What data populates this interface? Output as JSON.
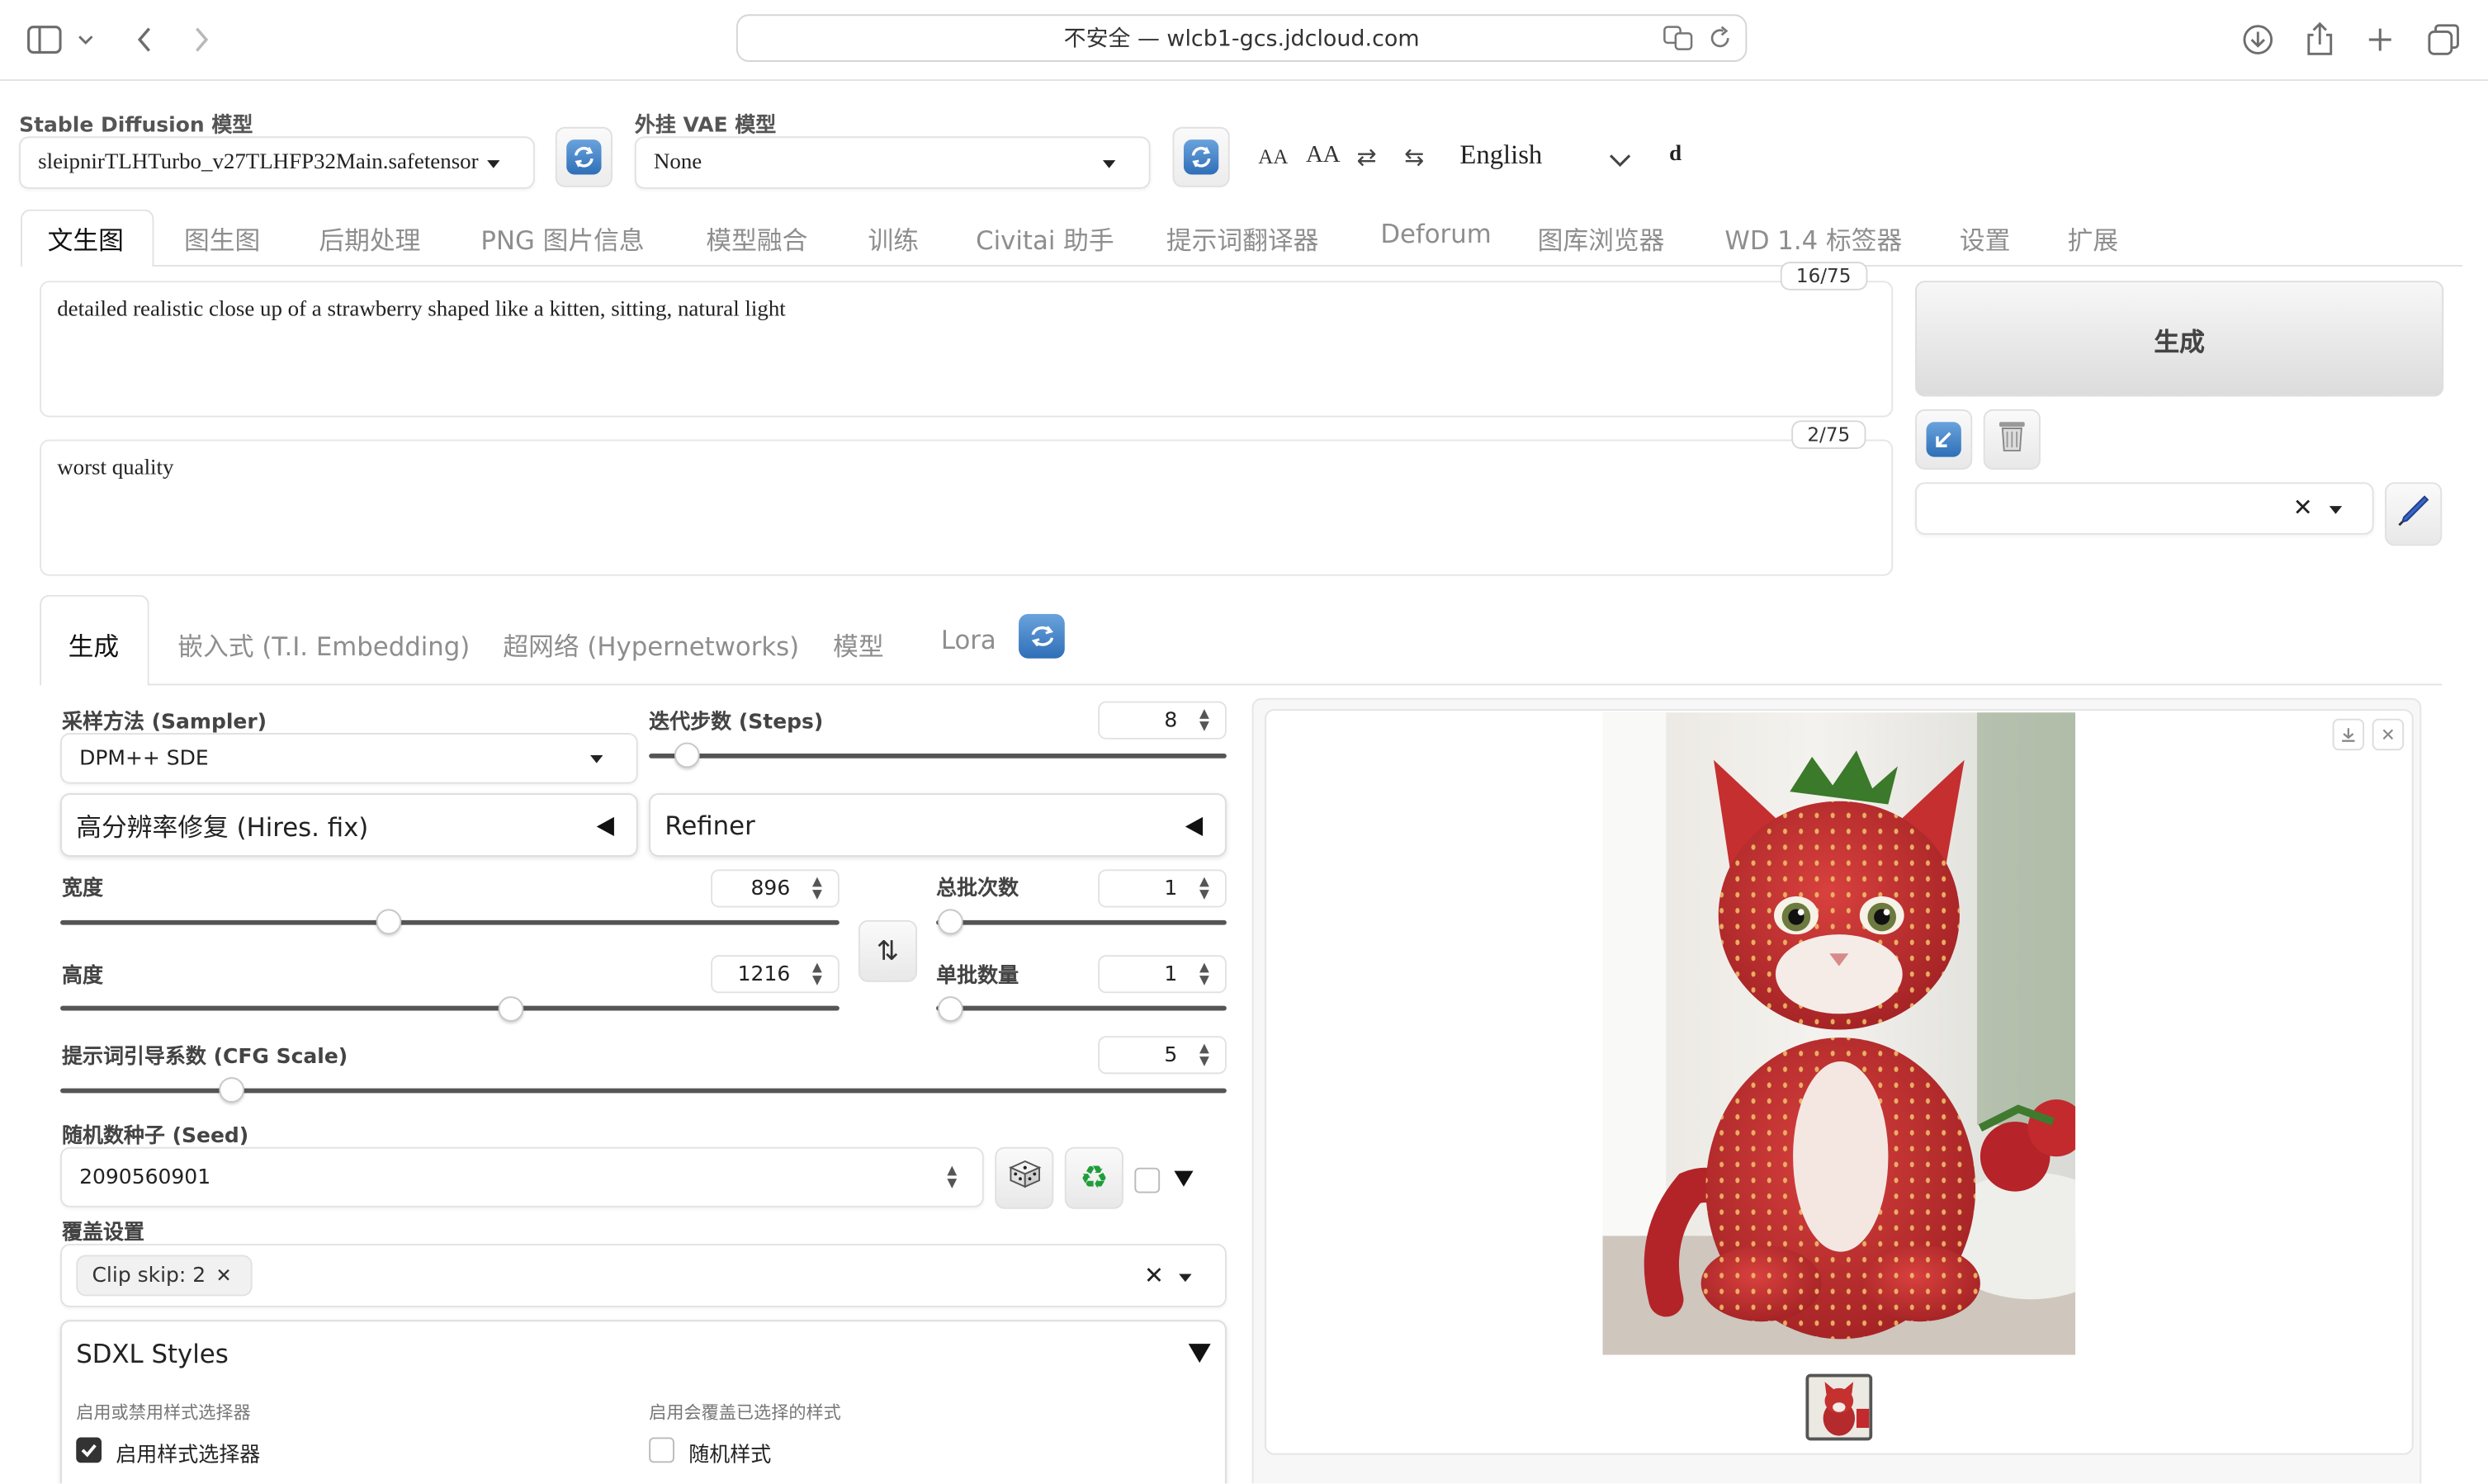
{
  "browser": {
    "url_text": "不安全 — wlcb1-gcs.jdcloud.com"
  },
  "top": {
    "sd_model_label": "Stable Diffusion 模型",
    "sd_model_value": "sleipnirTLHTurbo_v27TLHFP32Main.safetensor",
    "vae_label": "外挂 VAE 模型",
    "vae_value": "None",
    "font_small": "AA",
    "font_large": "AA",
    "language": "English",
    "extra_letter": "d"
  },
  "tabs": [
    "文生图",
    "图生图",
    "后期处理",
    "PNG 图片信息",
    "模型融合",
    "训练",
    "Civitai 助手",
    "提示词翻译器",
    "Deforum",
    "图库浏览器",
    "WD 1.4 标签器",
    "设置",
    "扩展"
  ],
  "prompt": {
    "positive": "detailed realistic close up of a strawberry shaped like a kitten, sitting, natural light",
    "positive_count": "16/75",
    "negative": "worst quality",
    "negative_count": "2/75"
  },
  "generate_label": "生成",
  "subtabs": [
    "生成",
    "嵌入式 (T.I. Embedding)",
    "超网络 (Hypernetworks)",
    "模型",
    "Lora"
  ],
  "params": {
    "sampler_label": "采样方法 (Sampler)",
    "sampler_value": "DPM++ SDE",
    "steps_label": "迭代步数 (Steps)",
    "steps_value": "8",
    "steps_fraction": 0.06,
    "hires_label": "高分辨率修复 (Hires. fix)",
    "refiner_label": "Refiner",
    "width_label": "宽度",
    "width_value": "896",
    "height_label": "高度",
    "height_value": "1216",
    "batch_count_label": "总批次数",
    "batch_count_value": "1",
    "batch_size_label": "单批数量",
    "batch_size_value": "1",
    "cfg_label": "提示词引导系数 (CFG Scale)",
    "cfg_value": "5",
    "seed_label": "随机数种子 (Seed)",
    "seed_value": "2090560901",
    "override_label": "覆盖设置",
    "override_chip": "Clip skip: 2",
    "sdxl_label": "SDXL Styles",
    "enable_hint": "启用或禁用样式选择器",
    "enable_label": "启用样式选择器",
    "random_hint": "启用会覆盖已选择的样式",
    "random_label": "随机样式"
  }
}
